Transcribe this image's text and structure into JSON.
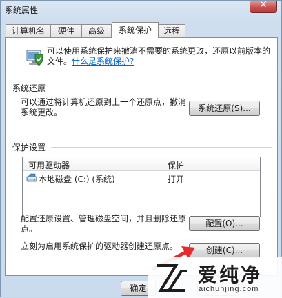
{
  "window": {
    "title": "系统属性",
    "close_glyph": "✕"
  },
  "tabs": [
    {
      "label": "计算机名",
      "active": false
    },
    {
      "label": "硬件",
      "active": false
    },
    {
      "label": "高级",
      "active": false
    },
    {
      "label": "系统保护",
      "active": true
    },
    {
      "label": "远程",
      "active": false
    }
  ],
  "intro": {
    "text": "可以使用系统保护来撤消不需要的系统更改，还原以前版本的文件。",
    "link": "什么是系统保护?"
  },
  "restore": {
    "section_label": "系统还原",
    "description": "可以通过将计算机还原到上一个还原点，撤消系统更改。",
    "button_label": "系统还原(S)..."
  },
  "protection": {
    "section_label": "保护设置",
    "columns": [
      "可用驱动器",
      "保护"
    ],
    "drives": [
      {
        "name": "本地磁盘 (C:) (系统)",
        "protection": "打开"
      }
    ],
    "configure_text": "配置还原设置、管理磁盘空间，并且删除还原点。",
    "configure_button": "配置(O)...",
    "create_text": "立刻为启用系统保护的驱动器创建还原点。",
    "create_button": "创建(C)..."
  },
  "footer": {
    "ok_label": "确定"
  },
  "watermark": {
    "brand": "爱纯净",
    "url": "aichunjing.com"
  },
  "colors": {
    "accent_arrow": "#e52b2b",
    "link": "#0066cc"
  }
}
